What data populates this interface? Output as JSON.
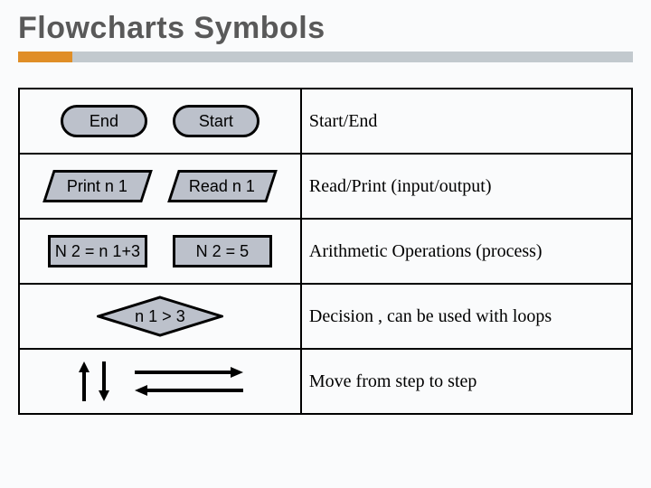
{
  "title": "Flowcharts Symbols",
  "rows": [
    {
      "shapeA": "End",
      "shapeB": "Start",
      "desc": "Start/End",
      "kind": "terminator"
    },
    {
      "shapeA": "Print n 1",
      "shapeB": "Read n 1",
      "desc": "Read/Print (input/output)",
      "kind": "parallelogram"
    },
    {
      "shapeA": "N 2 = n 1+3",
      "shapeB": "N 2 = 5",
      "desc": "Arithmetic Operations (process)",
      "kind": "process"
    },
    {
      "shapeA": "n 1 > 3",
      "desc": "Decision , can be used with loops",
      "kind": "decision"
    },
    {
      "desc": "Move from step to step",
      "kind": "arrows"
    }
  ]
}
